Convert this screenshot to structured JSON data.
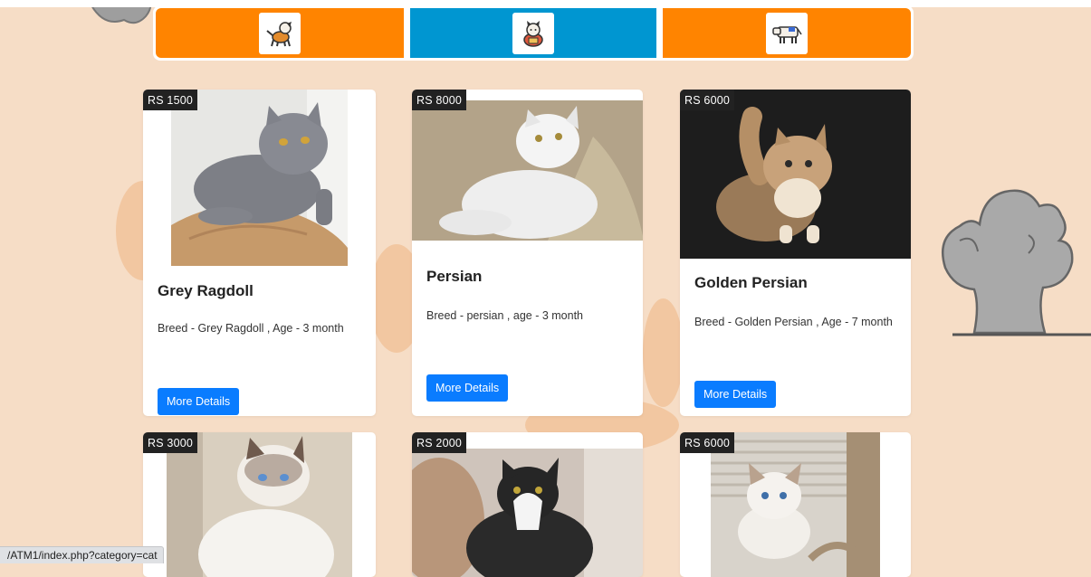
{
  "nav": {
    "tabs": [
      {
        "icon": "dog-icon",
        "color": "#ff8400"
      },
      {
        "icon": "cat-icon",
        "color": "#0096d1"
      },
      {
        "icon": "cow-icon",
        "color": "#ff8400"
      }
    ]
  },
  "products": [
    {
      "price": "RS 1500",
      "title": "Grey Ragdoll",
      "desc": "Breed - Grey Ragdoll , Age - 3 month",
      "button": "More Details"
    },
    {
      "price": "RS 8000",
      "title": "Persian",
      "desc": "Breed - persian , age - 3 month",
      "button": "More Details"
    },
    {
      "price": "RS 6000",
      "title": "Golden Persian",
      "desc": "Breed - Golden Persian , Age - 7 month",
      "button": "More Details"
    },
    {
      "price": "RS 3000"
    },
    {
      "price": "RS 2000"
    },
    {
      "price": "RS 6000"
    }
  ],
  "status_bar": {
    "url": "/ATM1/index.php?category=cat"
  },
  "colors": {
    "background": "#f6ddc6",
    "orange": "#ff8400",
    "blue": "#0096d1",
    "button": "#0a7cff"
  }
}
